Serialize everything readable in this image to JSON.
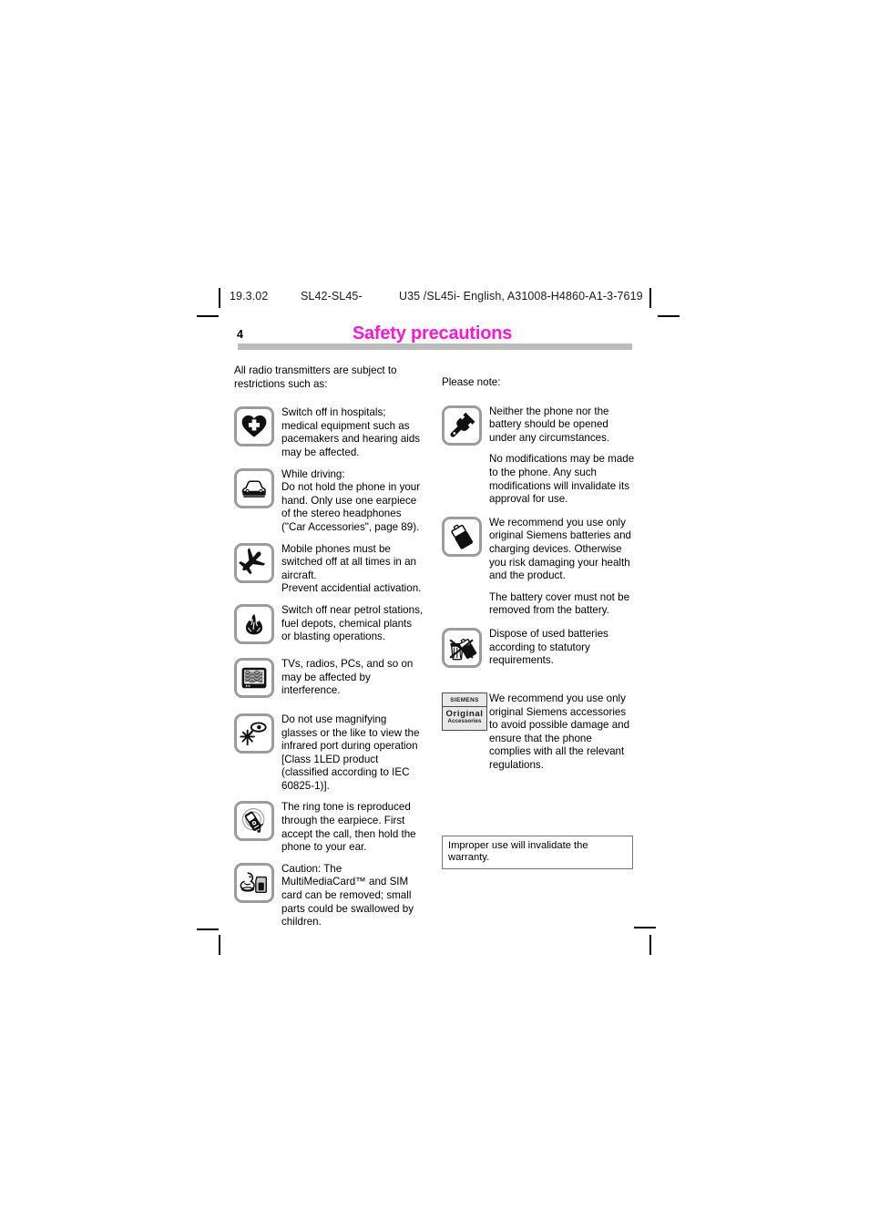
{
  "header": {
    "date": "19.3.02",
    "model": "SL42-SL45-",
    "document": "U35 /SL45i- English, A31008-H4860-A1-3-7619"
  },
  "page": {
    "number": "4",
    "chapter_title": "Safety precautions",
    "title_color": "#ff17d4",
    "rule_color": "#bcbcbc"
  },
  "left_column": {
    "lead": "All radio transmitters are subject to restrictions such as:",
    "items": [
      {
        "icon": "hospital-heart-cross-icon",
        "paragraphs": [
          "Switch off in hospitals; medical equipment such as pacemakers and  hearing aids may be affected."
        ]
      },
      {
        "icon": "car-icon",
        "paragraphs": [
          "While driving:",
          "Do not hold the phone in your hand. Only use one earpiece of the stereo headphones (\"Car Accessories\", page 89)."
        ]
      },
      {
        "icon": "airplane-icon",
        "paragraphs": [
          "Mobile phones must be switched off at all times in an aircraft.",
          "Prevent accidential activation."
        ]
      },
      {
        "icon": "flame-icon",
        "paragraphs": [
          "Switch off near petrol stations, fuel depots, chemical plants or blasting operations."
        ]
      },
      {
        "icon": "television-interference-icon",
        "paragraphs": [
          "TVs, radios, PCs, and so on may be affected by interference."
        ]
      },
      {
        "icon": "magnifying-glass-infrared-icon",
        "paragraphs": [
          "Do not use magnifying glasses or the like to view the infrared port during operation [Class 1LED product (classified according to IEC 60825-1)]."
        ]
      },
      {
        "icon": "ringtone-phone-icon",
        "paragraphs": [
          "The ring tone is reproduced through the earpiece. First accept the call, then hold the phone to your ear."
        ]
      },
      {
        "icon": "child-sim-card-icon",
        "paragraphs": [
          "Caution: The MultiMediaCard™ and SIM card can be removed; small parts could be swallowed by children."
        ]
      }
    ]
  },
  "right_column": {
    "lead": "Please note:",
    "items": [
      {
        "icon": "wrench-icon",
        "paragraphs": [
          "Neither the phone nor the battery should be opened under any circumstances.",
          "No modifications may be made to the phone. Any such modifications will invalidate its approval for use."
        ]
      },
      {
        "icon": "battery-icon",
        "paragraphs": [
          "We recommend you use only original Siemens batteries and charging devices. Otherwise you risk damaging your health and the product.",
          "The battery cover must not be removed from the battery."
        ]
      },
      {
        "icon": "battery-disposal-icon",
        "paragraphs": [
          "Dispose of used batteries according to statutory requirements."
        ]
      },
      {
        "icon": "siemens-original-accessories-mark",
        "mark": {
          "brand": "SIEMENS",
          "line1": "Original",
          "line2": "Accessories"
        },
        "paragraphs": [
          "We recommend you use only original Siemens accessories to avoid possible damage and ensure that the phone complies with all the relevant regulations."
        ]
      }
    ]
  },
  "warranty_note": "Improper use will invalidate the warranty."
}
